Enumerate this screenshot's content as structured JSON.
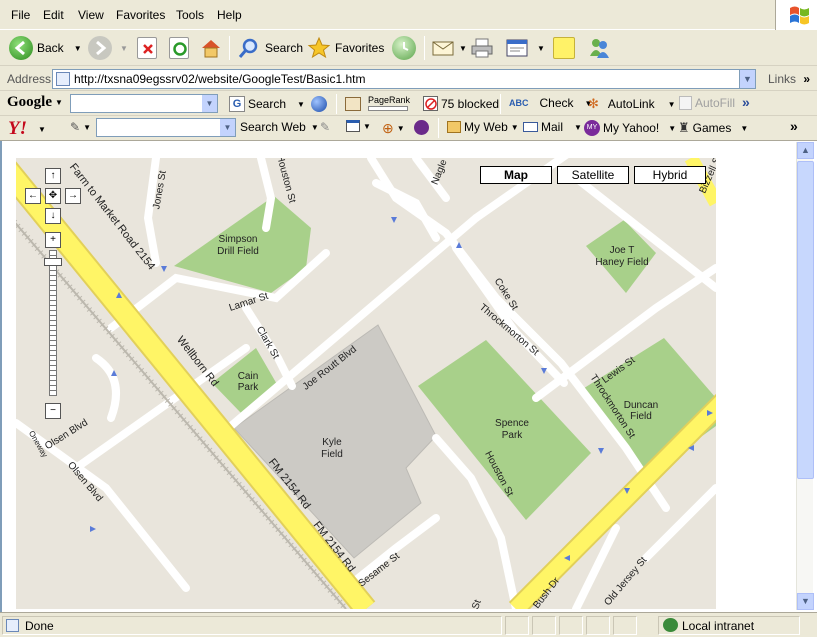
{
  "menu": [
    "File",
    "Edit",
    "View",
    "Favorites",
    "Tools",
    "Help"
  ],
  "toolbar": {
    "back": "Back",
    "search": "Search",
    "favorites": "Favorites"
  },
  "address": {
    "label": "Address",
    "url": "http://txsna09egssrv02/website/GoogleTest/Basic1.htm",
    "links": "Links"
  },
  "google_bar": {
    "logo": "Google",
    "search": "Search",
    "pagerank": "PageRank",
    "blocked": "75 blocked",
    "check": "Check",
    "autolink": "AutoLink",
    "autofill": "AutoFill"
  },
  "yahoo_bar": {
    "logo": "Y!",
    "search_web": "Search Web",
    "my_web": "My Web",
    "mail": "Mail",
    "my_yahoo": "My Yahoo!",
    "games": "Games"
  },
  "map": {
    "types": [
      "Map",
      "Satellite",
      "Hybrid"
    ],
    "selected_type": "Map",
    "labels": {
      "simpson_1": "Simpson",
      "simpson_2": "Drill Field",
      "lamar": "Lamar St",
      "clark": "Clark St",
      "cain_1": "Cain",
      "cain_2": "Park",
      "joe_routt": "Joe Routt Blvd",
      "kyle_1": "Kyle",
      "kyle_2": "Field",
      "wellborn": "Wellborn Rd",
      "fm2154_a": "FM 2154 Rd",
      "fm2154_b": "FM 2154 Rd",
      "farm_road": "Farm to Market Road 2154",
      "olsen_1": "Olsen Blvd",
      "olsen_2": "Olsen Blvd",
      "oneway": "Oneway",
      "jones": "Jones St",
      "houston_top": "Houston St",
      "nagle": "Nagle St",
      "coke": "Coke St",
      "throck_1": "Throckmorton St",
      "throck_2": "Throckmorton St",
      "joe_t_1": "Joe T",
      "joe_t_2": "Haney Field",
      "lewis": "Lewis St",
      "duncan_1": "Duncan",
      "duncan_2": "Field",
      "spence_1": "Spence",
      "spence_2": "Park",
      "houston": "Houston St",
      "sesame": "Sesame St",
      "bush": "e Bush Dr",
      "old_jersey": "Old Jersey St",
      "bizzell": "Bizzell St",
      "bottom_st": "St"
    }
  },
  "status": {
    "text": "Done",
    "zone": "Local intranet"
  },
  "colors": {
    "park": "#a8d08a",
    "highway": "#fff566",
    "map_bg": "#e9e5dc",
    "building": "#cccac5"
  }
}
